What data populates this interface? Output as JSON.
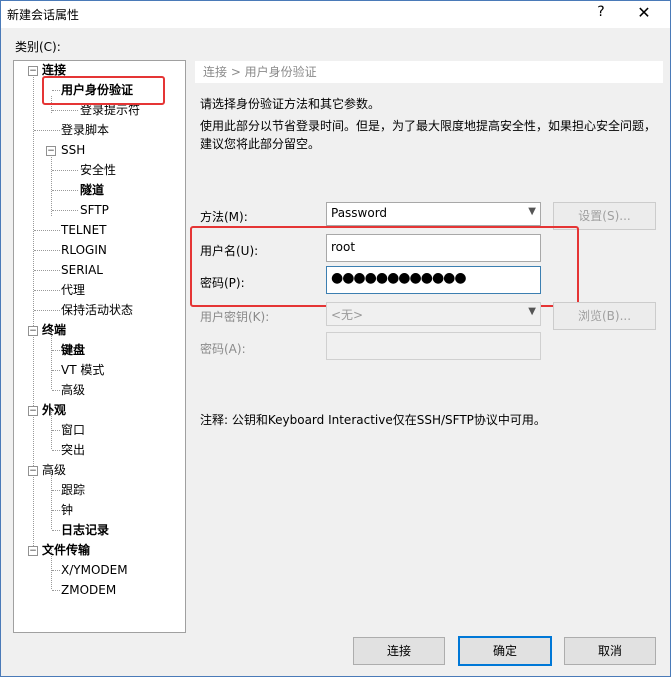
{
  "window": {
    "title": "新建会话属性",
    "help": "?",
    "close": "✕"
  },
  "category_label": "类别(C):",
  "tree": [
    {
      "label": "连接",
      "toggle": "−"
    },
    {
      "label": "用户身份验证"
    },
    {
      "label": "登录提示符"
    },
    {
      "label": "登录脚本"
    },
    {
      "label": "SSH",
      "toggle": "−"
    },
    {
      "label": "安全性"
    },
    {
      "label": "隧道"
    },
    {
      "label": "SFTP"
    },
    {
      "label": "TELNET"
    },
    {
      "label": "RLOGIN"
    },
    {
      "label": "SERIAL"
    },
    {
      "label": "代理"
    },
    {
      "label": "保持活动状态"
    },
    {
      "label": "终端",
      "toggle": "−"
    },
    {
      "label": "键盘"
    },
    {
      "label": "VT 模式"
    },
    {
      "label": "高级"
    },
    {
      "label": "外观",
      "toggle": "−"
    },
    {
      "label": "窗口"
    },
    {
      "label": "突出"
    },
    {
      "label": "高级",
      "toggle": "−"
    },
    {
      "label": "跟踪"
    },
    {
      "label": "钟"
    },
    {
      "label": "日志记录"
    },
    {
      "label": "文件传输",
      "toggle": "−"
    },
    {
      "label": "X/YMODEM"
    },
    {
      "label": "ZMODEM"
    }
  ],
  "breadcrumb": "连接 > 用户身份验证",
  "description": {
    "line1": "请选择身份验证方法和其它参数。",
    "line2": "使用此部分以节省登录时间。但是，为了最大限度地提高安全性，如果担心安全问题，建议您将此部分留空。"
  },
  "form": {
    "method_label": "方法(M):",
    "method_value": "Password",
    "settings_button": "设置(S)...",
    "username_label": "用户名(U):",
    "username_value": "root",
    "password_label": "密码(P):",
    "password_mask": "●●●●●●●●●●●●",
    "userkey_label": "用户密钥(K):",
    "userkey_value": "<无>",
    "browse_button": "浏览(B)...",
    "passphrase_label": "密码(A):"
  },
  "note": "注释: 公钥和Keyboard Interactive仅在SSH/SFTP协议中可用。",
  "buttons": {
    "connect": "连接",
    "ok": "确定",
    "cancel": "取消"
  },
  "colors": {
    "highlight": "#e53535",
    "focus": "#3c7fb1",
    "default_button": "#0078d7"
  }
}
